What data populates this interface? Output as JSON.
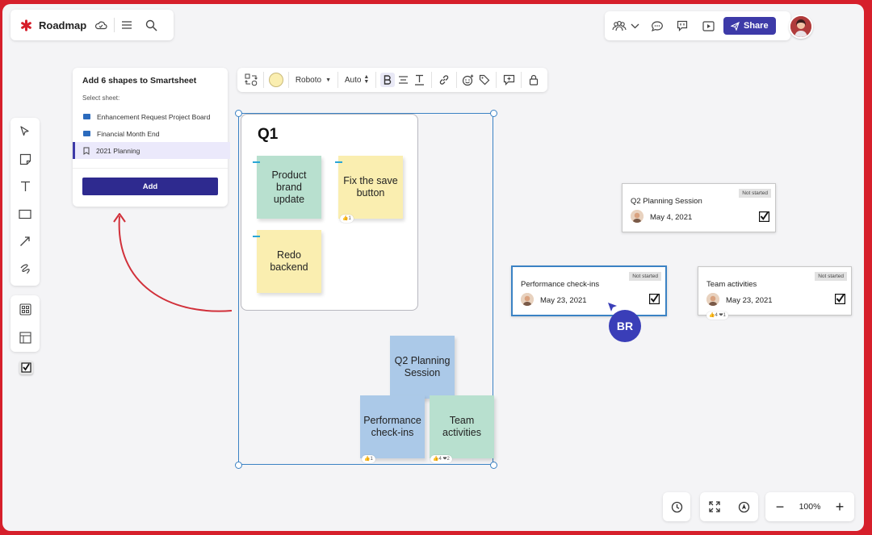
{
  "app": {
    "title": "Roadmap",
    "icons": [
      "asterisk-logo-icon",
      "cloud-icon",
      "menu-icon",
      "search-icon"
    ]
  },
  "topbar": {
    "icons": [
      "collaborators-icon",
      "chevron-down-icon",
      "comment-icon",
      "feedback-icon",
      "present-icon"
    ],
    "share_label": "Share"
  },
  "popup": {
    "title": "Add 6 shapes to Smartsheet",
    "select_label": "Select sheet:",
    "sheets": [
      {
        "label": "Enhancement Request Project Board",
        "icon": "folder-icon"
      },
      {
        "label": "Financial Month End",
        "icon": "folder-icon"
      },
      {
        "label": "2021 Planning",
        "icon": "sheet-icon"
      }
    ],
    "add_label": "Add"
  },
  "format_toolbar": {
    "font": "Roboto",
    "size": "Auto",
    "fill_color": "#faeeb0"
  },
  "board": {
    "frame_title": "Q1",
    "stickies": [
      {
        "text": "Product brand update",
        "color": "#b8e0cf"
      },
      {
        "text": "Fix the save button",
        "color": "#faeeb0"
      },
      {
        "text": "Redo backend",
        "color": "#faeeb0"
      },
      {
        "text": "Q2 Planning Session",
        "color": "#abc9e8"
      },
      {
        "text": "Performance check-ins",
        "color": "#abc9e8"
      },
      {
        "text": "Team activities",
        "color": "#b8e0cf"
      }
    ],
    "reactions": {
      "fix": "👍1",
      "perf": "👍1",
      "team": "👍4 ❤2"
    }
  },
  "cards": [
    {
      "name": "Q2 Planning Session",
      "status": "Not started",
      "date": "May 4, 2021"
    },
    {
      "name": "Performance check-ins",
      "status": "Not started",
      "date": "May 23, 2021"
    },
    {
      "name": "Team activities",
      "status": "Not started",
      "date": "May 23, 2021",
      "reactions": "👍4 ❤1"
    }
  ],
  "cursor": {
    "initials": "BR",
    "color": "#3a3eb8"
  },
  "zoom": {
    "level": "100%",
    "minus": "−",
    "plus": "+"
  },
  "colors": {
    "brand": "#d61f2b",
    "accent": "#3d3aa8",
    "selection": "#3b82c4"
  }
}
